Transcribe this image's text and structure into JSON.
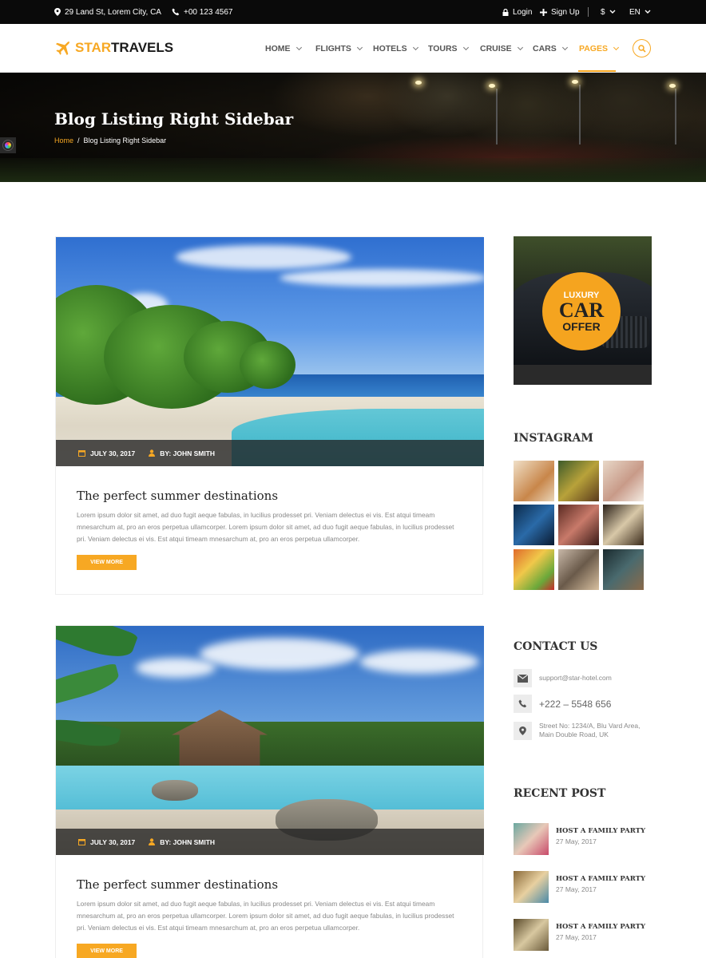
{
  "topbar": {
    "address": "29 Land St, Lorem City, CA",
    "phone": "+00 123 4567",
    "login": "Login",
    "signup": "Sign Up",
    "currency": "$",
    "language": "EN"
  },
  "logo": {
    "part1": "STAR",
    "part2": "TRAVELS"
  },
  "nav": [
    {
      "label": "HOME"
    },
    {
      "label": "FLIGHTS"
    },
    {
      "label": "HOTELS"
    },
    {
      "label": "TOURS"
    },
    {
      "label": "CRUISE"
    },
    {
      "label": "CARS"
    },
    {
      "label": "PAGES"
    }
  ],
  "hero": {
    "title": "Blog Listing Right Sidebar",
    "breadcrumb_home": "Home",
    "breadcrumb_sep": "/",
    "breadcrumb_current": "Blog Listing Right Sidebar"
  },
  "posts": [
    {
      "date": "JULY 30, 2017",
      "author": "BY: JOHN SMITH",
      "title": "The perfect summer destinations",
      "excerpt": "Lorem ipsum dolor sit amet, ad duo fugit aeque fabulas, in lucilius prodesset pri. Veniam delectus ei vis. Est atqui timeam mnesarchum at, pro an eros perpetua ullamcorper. Lorem ipsum dolor sit amet, ad duo fugit aeque fabulas, in lucilius prodesset pri. Veniam delectus ei vis. Est atqui timeam mnesarchum at, pro an eros perpetua ullamcorper.",
      "button": "VIEW MORE"
    },
    {
      "date": "JULY 30, 2017",
      "author": "BY: JOHN SMITH",
      "title": "The perfect summer destinations",
      "excerpt": "Lorem ipsum dolor sit amet, ad duo fugit aeque fabulas, in lucilius prodesset pri. Veniam delectus ei vis. Est atqui timeam mnesarchum at, pro an eros perpetua ullamcorper. Lorem ipsum dolor sit amet, ad duo fugit aeque fabulas, in lucilius prodesset pri. Veniam delectus ei vis. Est atqui timeam mnesarchum at, pro an eros perpetua ullamcorper.",
      "button": "VIEW MORE"
    }
  ],
  "sidebar": {
    "ad": {
      "line1": "LUXURY",
      "line2": "CAR",
      "line3": "OFFER"
    },
    "instagram_title": "INSTAGRAM",
    "contact_title": "CONTACT US",
    "contact": {
      "email": "support@star-hotel.com",
      "phone": "+222 – 5548 656",
      "address_line1": "Street No: 1234/A, Blu Vard Area,",
      "address_line2": "Main Double Road, UK"
    },
    "recent_title": "RECENT POST",
    "recent_posts": [
      {
        "title": "HOST A FAMILY PARTY",
        "date": "27 May, 2017"
      },
      {
        "title": "HOST A FAMILY PARTY",
        "date": "27 May, 2017"
      },
      {
        "title": "HOST A FAMILY PARTY",
        "date": "27 May, 2017"
      }
    ]
  },
  "colors": {
    "accent": "#f7a823",
    "topbar": "#0a0a0a"
  },
  "icons": [
    "map-marker-icon",
    "phone-icon",
    "lock-icon",
    "plus-icon",
    "chevron-down-icon",
    "plane-icon",
    "search-icon",
    "calendar-icon",
    "user-icon",
    "envelope-icon",
    "location-icon"
  ]
}
